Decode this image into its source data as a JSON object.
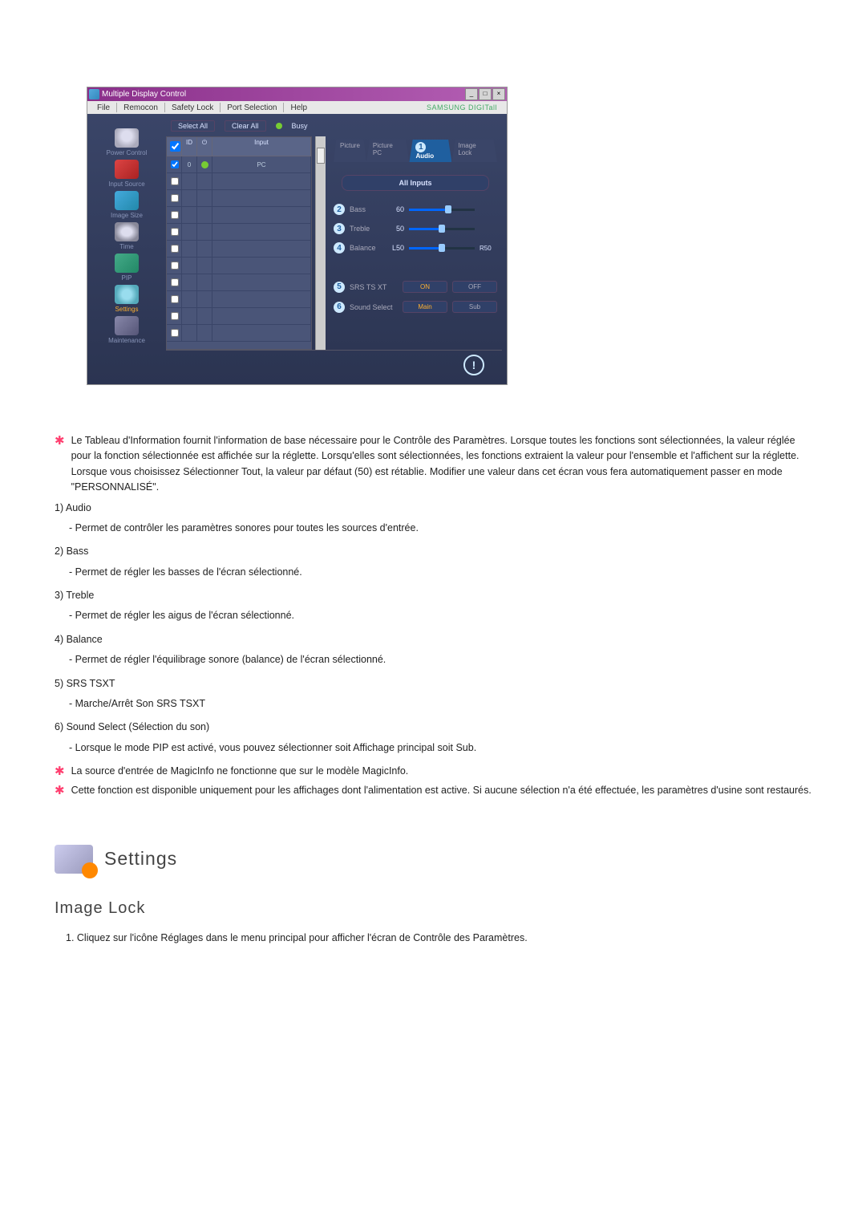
{
  "window": {
    "title": "Multiple Display Control",
    "menus": [
      "File",
      "Remocon",
      "Safety Lock",
      "Port Selection",
      "Help"
    ],
    "brand": "SAMSUNG DIGITall"
  },
  "sidebar": {
    "items": [
      {
        "label": "Power Control"
      },
      {
        "label": "Input Source"
      },
      {
        "label": "Image Size"
      },
      {
        "label": "Time"
      },
      {
        "label": "PIP"
      },
      {
        "label": "Settings"
      },
      {
        "label": "Maintenance"
      }
    ]
  },
  "toolbar": {
    "selectAll": "Select All",
    "clearAll": "Clear All",
    "busy": "Busy"
  },
  "grid": {
    "head": {
      "id": "ID",
      "power": "⏻",
      "input": "Input"
    },
    "row0": {
      "id": "0",
      "input": "PC"
    }
  },
  "panel": {
    "tabs": {
      "picture": "Picture",
      "picturePc": "Picture PC",
      "audioNum": "1",
      "audio": "Audio",
      "imageLock": "Image Lock"
    },
    "allInputs": "All Inputs",
    "rows": {
      "bass": {
        "num": "2",
        "label": "Bass",
        "val": "60"
      },
      "treble": {
        "num": "3",
        "label": "Treble",
        "val": "50"
      },
      "balance": {
        "num": "4",
        "label": "Balance",
        "left": "L50",
        "right": "R50"
      }
    },
    "srs": {
      "num": "5",
      "label": "SRS TS XT",
      "on": "ON",
      "off": "OFF"
    },
    "sound": {
      "num": "6",
      "label": "Sound Select",
      "main": "Main",
      "sub": "Sub"
    }
  },
  "doc": {
    "starIntro": "Le Tableau d'Information fournit l'information de base nécessaire pour le Contrôle des Paramètres. Lorsque toutes les fonctions sont sélectionnées, la valeur réglée pour la fonction sélectionnée est affichée sur la réglette. Lorsqu'elles sont sélectionnées, les fonctions extraient la valeur pour l'ensemble et l'affichent sur la réglette. Lorsque vous choisissez Sélectionner Tout, la valeur par défaut (50) est rétablie. Modifier une valeur dans cet écran vous fera automatiquement passer en mode \"PERSONNALISÉ\".",
    "i1": {
      "t": "1)  Audio",
      "d": "- Permet de contrôler les paramètres sonores pour toutes les sources d'entrée."
    },
    "i2": {
      "t": "2)  Bass",
      "d": "- Permet de régler les basses de l'écran sélectionné."
    },
    "i3": {
      "t": "3)  Treble",
      "d": "- Permet de régler les aigus de l'écran sélectionné."
    },
    "i4": {
      "t": "4)  Balance",
      "d": "- Permet de régler l'équilibrage sonore (balance) de l'écran sélectionné."
    },
    "i5": {
      "t": "5)  SRS TSXT",
      "d": "- Marche/Arrêt Son SRS TSXT"
    },
    "i6": {
      "t": "6)  Sound Select (Sélection du son)",
      "d": "- Lorsque le mode PIP est activé, vous pouvez sélectionner soit Affichage principal soit Sub."
    },
    "star2": "La source d'entrée de MagicInfo ne fonctionne que sur le modèle MagicInfo.",
    "star3": "Cette fonction est disponible uniquement pour les affichages dont l'alimentation est active. Si aucune sélection n'a été effectuée, les paramètres d'usine sont restaurés.",
    "settingsTitle": "Settings",
    "imageLockTitle": "Image Lock",
    "imageLockStep": "1.  Cliquez sur l'icône Réglages dans le menu principal pour afficher l'écran de Contrôle des Paramètres."
  }
}
